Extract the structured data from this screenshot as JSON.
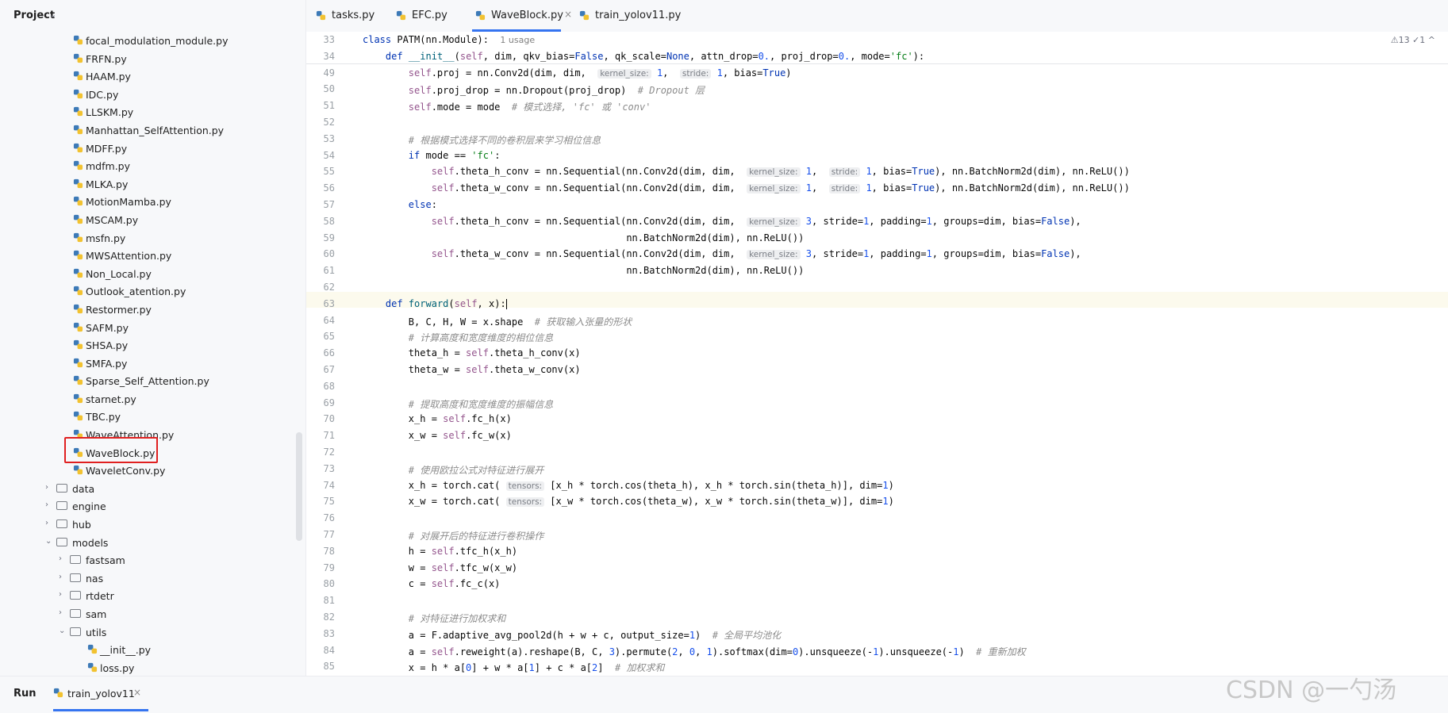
{
  "project": {
    "title": "Project",
    "files": [
      "focal_modulation_module.py",
      "FRFN.py",
      "HAAM.py",
      "IDC.py",
      "LLSKM.py",
      "Manhattan_SelfAttention.py",
      "MDFF.py",
      "mdfm.py",
      "MLKA.py",
      "MotionMamba.py",
      "MSCAM.py",
      "msfn.py",
      "MWSAttention.py",
      "Non_Local.py",
      "Outlook_atention.py",
      "Restormer.py",
      "SAFM.py",
      "SHSA.py",
      "SMFA.py",
      "Sparse_Self_Attention.py",
      "starnet.py",
      "TBC.py",
      "WaveAttention.py",
      "WaveBlock.py",
      "WaveletConv.py"
    ],
    "folders": [
      "data",
      "engine",
      "hub",
      "models"
    ],
    "model_subfolders": [
      "fastsam",
      "nas",
      "rtdetr",
      "sam",
      "utils"
    ],
    "utils_files": [
      "__init__.py",
      "loss.py"
    ]
  },
  "tabs": [
    {
      "label": "tasks.py"
    },
    {
      "label": "EFC.py"
    },
    {
      "label": "WaveBlock.py",
      "close": "×"
    },
    {
      "label": "train_yolov11.py"
    }
  ],
  "inspections": "⚠13 ✓1 ^",
  "run": {
    "label": "Run",
    "tab": "train_yolov11",
    "close": "×"
  },
  "watermark": "CSDN @一勺汤",
  "colors": {
    "accent": "#3574f0",
    "highlight_box": "#e02020",
    "keyword": "#0033b3",
    "string": "#067d17",
    "number": "#1750eb",
    "comment": "#8c8c8c",
    "self": "#94558d"
  },
  "code_lines": [
    {
      "n": "33",
      "html": "<span class=\"kw\">class</span> PATM(nn.Module):  <span class=\"usage\">1 usage</span>"
    },
    {
      "n": "34",
      "html": "    <span class=\"kw\">def</span> <span class=\"fn\">__init__</span>(<span class=\"self\">self</span>, dim, qkv_bias=<span class=\"kw\">False</span>, qk_scale=<span class=\"kw\">None</span>, attn_drop=<span class=\"num\">0.</span>, proj_drop=<span class=\"num\">0.</span>, mode=<span class=\"str\">'fc'</span>):"
    },
    {
      "n": "49",
      "html": "        <span class=\"self\">self</span>.proj = nn.Conv2d(dim, dim,  <span class=\"hint\">kernel_size:</span> <span class=\"num\">1</span>,  <span class=\"hint\">stride:</span> <span class=\"num\">1</span>, bias=<span class=\"kw\">True</span>)"
    },
    {
      "n": "50",
      "html": "        <span class=\"self\">self</span>.proj_drop = nn.Dropout(proj_drop)  <span class=\"cmt\"># Dropout 层</span>"
    },
    {
      "n": "51",
      "html": "        <span class=\"self\">self</span>.mode = mode  <span class=\"cmt\"># 模式选择, 'fc' 或 'conv'</span>"
    },
    {
      "n": "52",
      "html": ""
    },
    {
      "n": "53",
      "html": "        <span class=\"cmt\"># 根据模式选择不同的卷积层来学习相位信息</span>"
    },
    {
      "n": "54",
      "html": "        <span class=\"kw\">if</span> mode == <span class=\"str\">'fc'</span>:"
    },
    {
      "n": "55",
      "html": "            <span class=\"self\">self</span>.theta_h_conv = nn.Sequential(nn.Conv2d(dim, dim,  <span class=\"hint\">kernel_size:</span> <span class=\"num\">1</span>,  <span class=\"hint\">stride:</span> <span class=\"num\">1</span>, bias=<span class=\"kw\">True</span>), nn.BatchNorm2d(dim), nn.ReLU())"
    },
    {
      "n": "56",
      "html": "            <span class=\"self\">self</span>.theta_w_conv = nn.Sequential(nn.Conv2d(dim, dim,  <span class=\"hint\">kernel_size:</span> <span class=\"num\">1</span>,  <span class=\"hint\">stride:</span> <span class=\"num\">1</span>, bias=<span class=\"kw\">True</span>), nn.BatchNorm2d(dim), nn.ReLU())"
    },
    {
      "n": "57",
      "html": "        <span class=\"kw\">else</span>:"
    },
    {
      "n": "58",
      "html": "            <span class=\"self\">self</span>.theta_h_conv = nn.Sequential(nn.Conv2d(dim, dim,  <span class=\"hint\">kernel_size:</span> <span class=\"num\">3</span>, stride=<span class=\"num\">1</span>, padding=<span class=\"num\">1</span>, groups=dim, bias=<span class=\"kw\">False</span>),"
    },
    {
      "n": "59",
      "html": "                                              nn.BatchNorm2d(dim), nn.ReLU())"
    },
    {
      "n": "60",
      "html": "            <span class=\"self\">self</span>.theta_w_conv = nn.Sequential(nn.Conv2d(dim, dim,  <span class=\"hint\">kernel_size:</span> <span class=\"num\">3</span>, stride=<span class=\"num\">1</span>, padding=<span class=\"num\">1</span>, groups=dim, bias=<span class=\"kw\">False</span>),"
    },
    {
      "n": "61",
      "html": "                                              nn.BatchNorm2d(dim), nn.ReLU())"
    },
    {
      "n": "62",
      "html": ""
    },
    {
      "n": "63",
      "html": "    <span class=\"kw\">def</span> <span class=\"fn\">forward</span>(<span class=\"self\">self</span>, x):<span class=\"caret\"></span>"
    },
    {
      "n": "64",
      "html": "        B, C, H, W = x.shape  <span class=\"cmt\"># 获取输入张量的形状</span>"
    },
    {
      "n": "65",
      "html": "        <span class=\"cmt\"># 计算高度和宽度维度的相位信息</span>"
    },
    {
      "n": "66",
      "html": "        theta_h = <span class=\"self\">self</span>.theta_h_conv(x)"
    },
    {
      "n": "67",
      "html": "        theta_w = <span class=\"self\">self</span>.theta_w_conv(x)"
    },
    {
      "n": "68",
      "html": ""
    },
    {
      "n": "69",
      "html": "        <span class=\"cmt\"># 提取高度和宽度维度的振幅信息</span>"
    },
    {
      "n": "70",
      "html": "        x_h = <span class=\"self\">self</span>.fc_h(x)"
    },
    {
      "n": "71",
      "html": "        x_w = <span class=\"self\">self</span>.fc_w(x)"
    },
    {
      "n": "72",
      "html": ""
    },
    {
      "n": "73",
      "html": "        <span class=\"cmt\"># 使用欧拉公式对特征进行展开</span>"
    },
    {
      "n": "74",
      "html": "        x_h = torch.cat( <span class=\"hint\">tensors:</span> [x_h * torch.cos(theta_h), x_h * torch.sin(theta_h)], dim=<span class=\"num\">1</span>)"
    },
    {
      "n": "75",
      "html": "        x_w = torch.cat( <span class=\"hint\">tensors:</span> [x_w * torch.cos(theta_w), x_w * torch.sin(theta_w)], dim=<span class=\"num\">1</span>)"
    },
    {
      "n": "76",
      "html": ""
    },
    {
      "n": "77",
      "html": "        <span class=\"cmt\"># 对展开后的特征进行卷积操作</span>"
    },
    {
      "n": "78",
      "html": "        h = <span class=\"self\">self</span>.tfc_h(x_h)"
    },
    {
      "n": "79",
      "html": "        w = <span class=\"self\">self</span>.tfc_w(x_w)"
    },
    {
      "n": "80",
      "html": "        c = <span class=\"self\">self</span>.fc_c(x)"
    },
    {
      "n": "81",
      "html": ""
    },
    {
      "n": "82",
      "html": "        <span class=\"cmt\"># 对特征进行加权求和</span>"
    },
    {
      "n": "83",
      "html": "        a = F.adaptive_avg_pool2d(h + w + c, output_size=<span class=\"num\">1</span>)  <span class=\"cmt\"># 全局平均池化</span>"
    },
    {
      "n": "84",
      "html": "        a = <span class=\"self\">self</span>.reweight(a).reshape(B, C, <span class=\"num\">3</span>).permute(<span class=\"num\">2</span>, <span class=\"num\">0</span>, <span class=\"num\">1</span>).softmax(dim=<span class=\"num\">0</span>).unsqueeze(-<span class=\"num\">1</span>).unsqueeze(-<span class=\"num\">1</span>)  <span class=\"cmt\"># 重新加权</span>"
    },
    {
      "n": "85",
      "html": "        x = h * a[<span class=\"num\">0</span>] + w * a[<span class=\"num\">1</span>] + c * a[<span class=\"num\">2</span>]  <span class=\"cmt\"># 加权求和</span>"
    }
  ]
}
